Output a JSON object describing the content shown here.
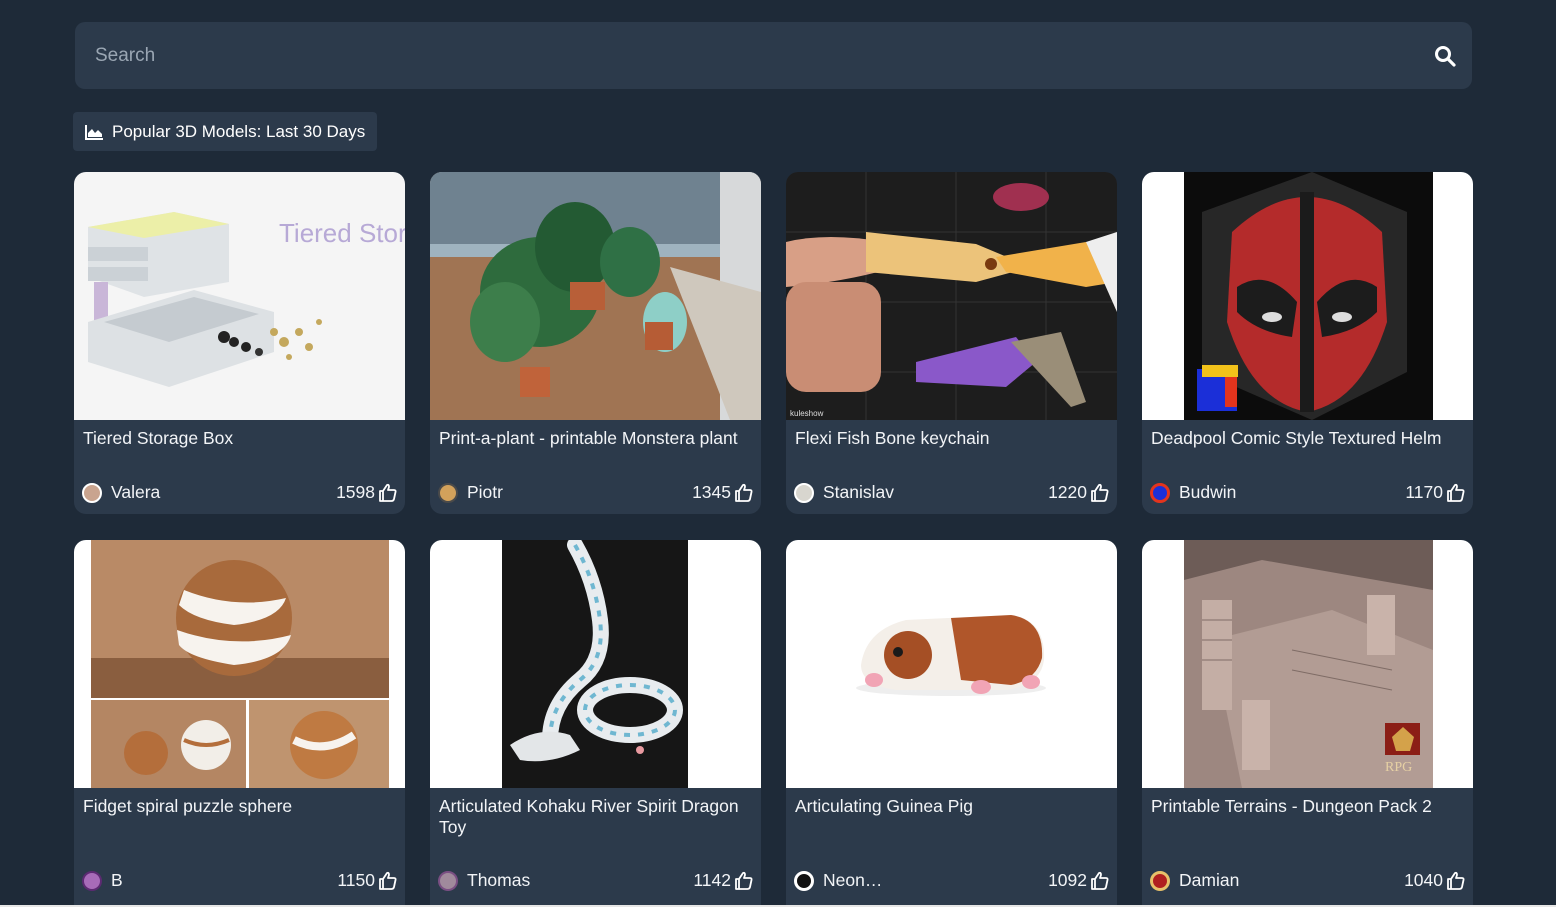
{
  "search": {
    "placeholder": "Search"
  },
  "section": {
    "label": "Popular 3D Models: Last 30 Days"
  },
  "models": [
    {
      "title": "Tiered Storage Box",
      "author": "Valera",
      "likes": "1598",
      "thumb_text": "Tiered Storage Box"
    },
    {
      "title": "Print-a-plant - printable Monstera plant",
      "author": "Piotr",
      "likes": "1345"
    },
    {
      "title": "Flexi Fish Bone keychain",
      "author": "Stanislav",
      "likes": "1220",
      "thumb_text": "kuleshow"
    },
    {
      "title": "Deadpool Comic Style Textured Helm",
      "author": "Budwin",
      "likes": "1170"
    },
    {
      "title": "Fidget spiral puzzle sphere",
      "author": "B",
      "likes": "1150"
    },
    {
      "title": "Articulated Kohaku River Spirit Dragon Toy",
      "author": "Thomas",
      "likes": "1142"
    },
    {
      "title": "Articulating Guinea Pig",
      "author": "Neon…",
      "likes": "1092"
    },
    {
      "title": "Printable Terrains - Dungeon Pack 2",
      "author": "Damian",
      "likes": "1040",
      "thumb_text": "RPG"
    }
  ],
  "colors": {
    "background": "#1e2a38",
    "card": "#2c3a4b",
    "text": "#f2f4f7"
  }
}
